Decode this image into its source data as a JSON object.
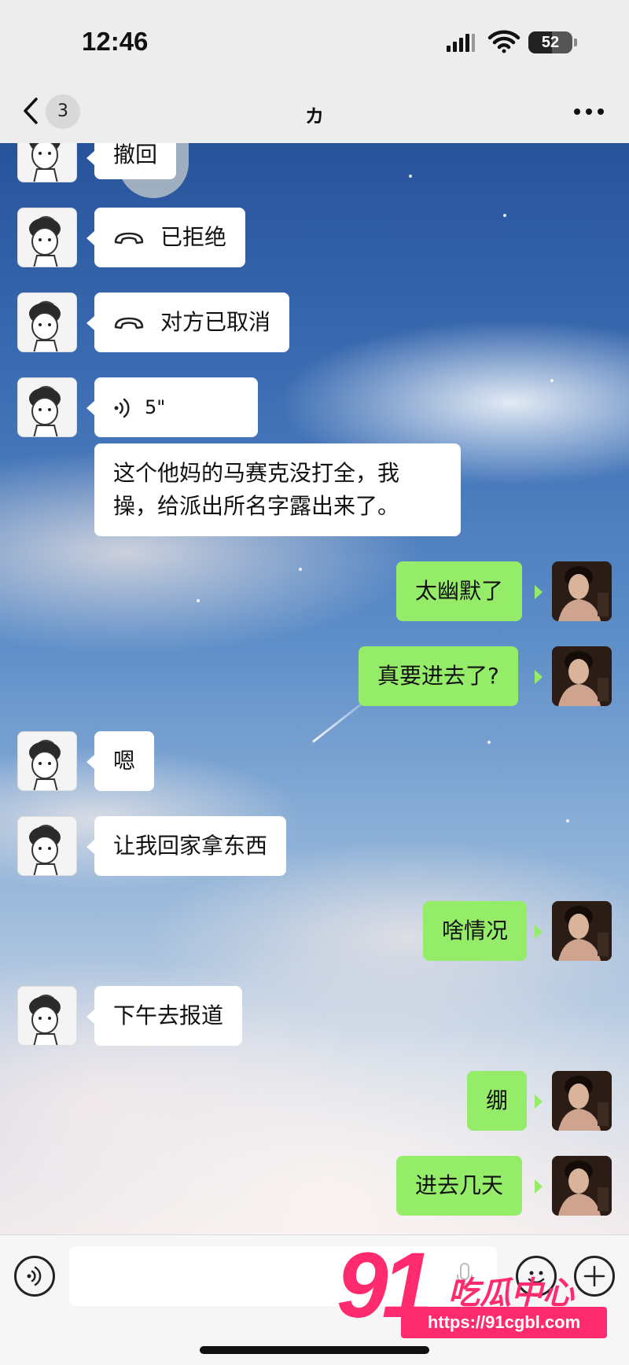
{
  "status_bar": {
    "time": "12:46",
    "battery": "52"
  },
  "nav": {
    "unread_count": "3",
    "title": "カ"
  },
  "messages": [
    {
      "side": "in",
      "type": "text",
      "text": "撤回"
    },
    {
      "side": "in",
      "type": "call",
      "text": "已拒绝"
    },
    {
      "side": "in",
      "type": "call",
      "text": "对方已取消"
    },
    {
      "side": "in",
      "type": "voice",
      "text": "5\""
    },
    {
      "side": "in",
      "type": "text",
      "text": "这个他妈的马赛克没打全，我操，给派出所名字露出来了。"
    },
    {
      "side": "out",
      "type": "text",
      "text": "太幽默了"
    },
    {
      "side": "out",
      "type": "text",
      "text": "真要进去了?"
    },
    {
      "side": "in",
      "type": "text",
      "text": "嗯"
    },
    {
      "side": "in",
      "type": "text",
      "text": "让我回家拿东西"
    },
    {
      "side": "out",
      "type": "text",
      "text": "啥情况"
    },
    {
      "side": "in",
      "type": "text",
      "text": "下午去报道"
    },
    {
      "side": "out",
      "type": "text",
      "text": "绷"
    },
    {
      "side": "out",
      "type": "text",
      "text": "进去几天"
    }
  ],
  "watermark": {
    "number": "91",
    "name": "吃瓜中心",
    "url": "https://91cgbl.com"
  },
  "colors": {
    "bubble_out": "#95ec69",
    "bubble_in": "#ffffff",
    "watermark": "#ff2b6e"
  }
}
